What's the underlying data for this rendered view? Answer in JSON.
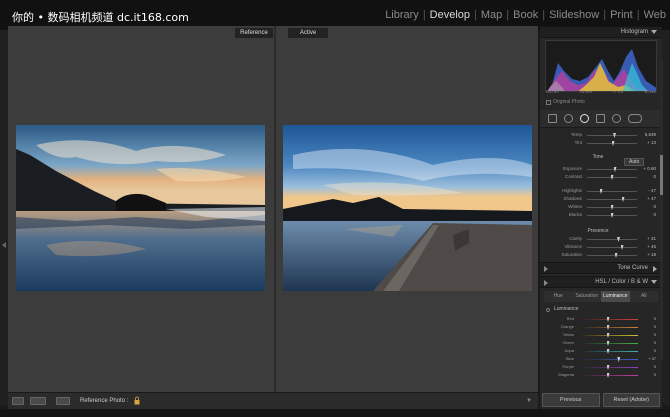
{
  "watermark": "你的 • 数码相机频道  dc.it168.com",
  "modules": [
    {
      "label": "Library",
      "active": false
    },
    {
      "label": "Develop",
      "active": true
    },
    {
      "label": "Map",
      "active": false
    },
    {
      "label": "Book",
      "active": false
    },
    {
      "label": "Slideshow",
      "active": false
    },
    {
      "label": "Print",
      "active": false
    },
    {
      "label": "Web",
      "active": false
    }
  ],
  "viewer": {
    "reference_tab": "Reference",
    "active_tab": "Active"
  },
  "toolbar": {
    "reference_photo_label": "Reference Photo :"
  },
  "panel": {
    "histogram_label": "Histogram",
    "histogram_info": [
      "ISO 50",
      "24 mm",
      "f / 9.5",
      "30 sec"
    ],
    "original_photo_label": "Original Photo",
    "wb_rows": [
      {
        "label": "Temp",
        "value": "5,639",
        "pos": 0.55
      },
      {
        "label": "Tint",
        "value": "+ 13",
        "pos": 0.52
      }
    ],
    "tone_label": "Tone",
    "auto_label": "Auto",
    "tone_rows": [
      {
        "label": "Exposure",
        "value": "+ 0.60",
        "pos": 0.56
      },
      {
        "label": "Contrast",
        "value": "0",
        "pos": 0.5
      }
    ],
    "tone_rows2": [
      {
        "label": "Highlights",
        "value": "- 47",
        "pos": 0.28
      },
      {
        "label": "Shadows",
        "value": "+ 47",
        "pos": 0.72
      },
      {
        "label": "Whites",
        "value": "0",
        "pos": 0.5
      },
      {
        "label": "Blacks",
        "value": "0",
        "pos": 0.5
      }
    ],
    "presence_label": "Presence",
    "presence_rows": [
      {
        "label": "Clarity",
        "value": "+ 31",
        "pos": 0.63
      },
      {
        "label": "Vibrance",
        "value": "+ 45",
        "pos": 0.7
      },
      {
        "label": "Saturation",
        "value": "+ 18",
        "pos": 0.58
      }
    ],
    "tone_curve_label": "Tone Curve",
    "hsl_header": "HSL  /  Color  /  B & W",
    "hsl_tabs": [
      "Hue",
      "Saturation",
      "Luminance",
      "All"
    ],
    "hsl_selected": "Luminance",
    "luminance_label": "Luminance",
    "luminance_rows": [
      {
        "label": "Red",
        "value": "0",
        "pos": 0.5,
        "color": "#d04040"
      },
      {
        "label": "Orange",
        "value": "0",
        "pos": 0.5,
        "color": "#d08030"
      },
      {
        "label": "Yellow",
        "value": "0",
        "pos": 0.5,
        "color": "#d0c030"
      },
      {
        "label": "Green",
        "value": "0",
        "pos": 0.5,
        "color": "#40b040"
      },
      {
        "label": "Aqua",
        "value": "0",
        "pos": 0.5,
        "color": "#40b0b0"
      },
      {
        "label": "Blue",
        "value": "+ 37",
        "pos": 0.68,
        "color": "#4060d0"
      },
      {
        "label": "Purple",
        "value": "0",
        "pos": 0.5,
        "color": "#9040c0"
      },
      {
        "label": "Magenta",
        "value": "0",
        "pos": 0.5,
        "color": "#c040a0"
      }
    ],
    "previous_label": "Previous",
    "reset_label": "Reset (Adobe)"
  }
}
